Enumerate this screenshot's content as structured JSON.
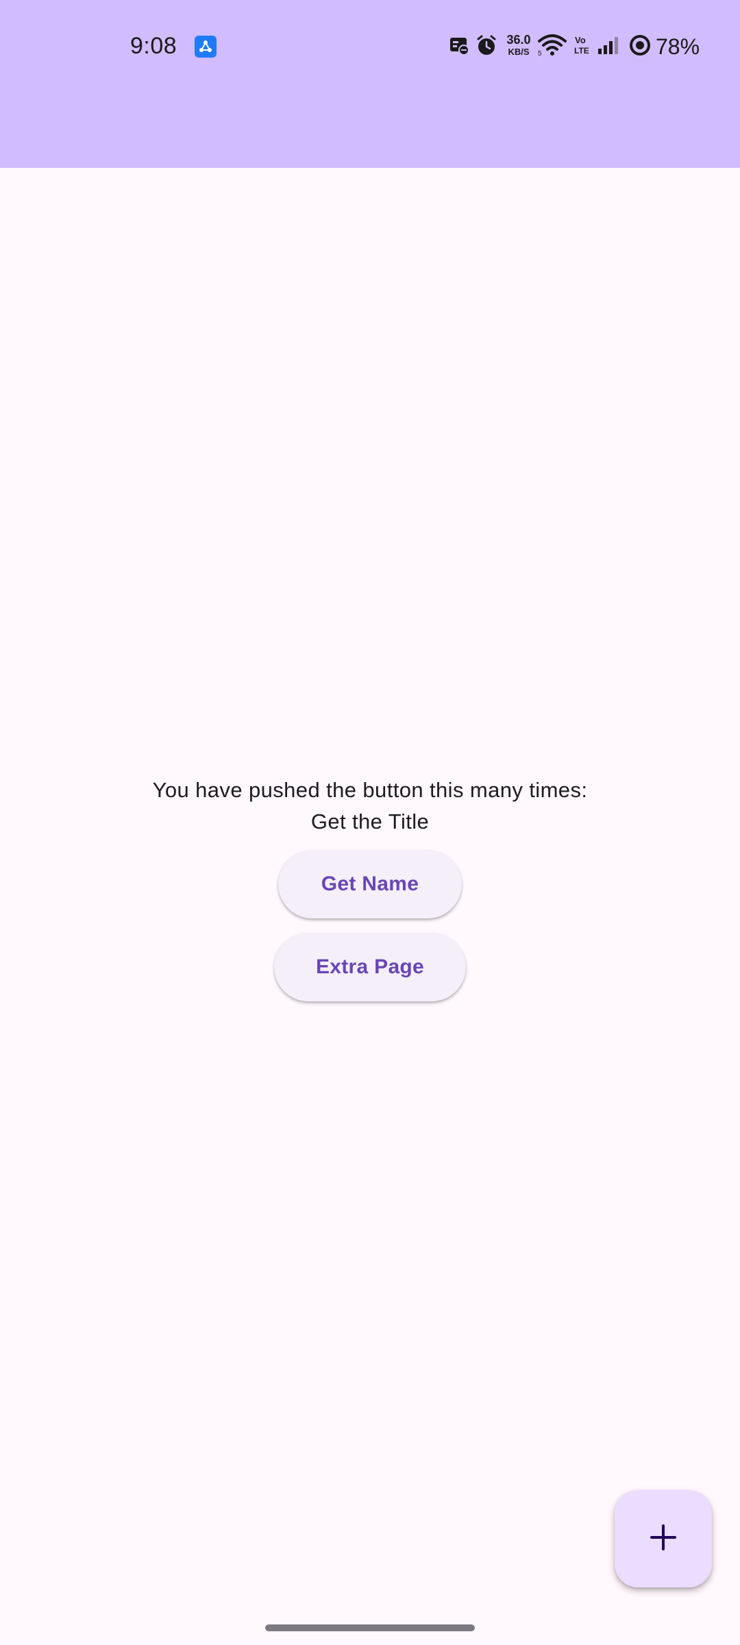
{
  "status_bar": {
    "time": "9:08",
    "net_speed_value": "36.0",
    "net_speed_unit": "KB/S",
    "battery_percent": "78%",
    "icons": [
      "app-badge-icon",
      "notification-icon",
      "alarm-icon",
      "net-speed",
      "wifi-icon",
      "volte-icon",
      "signal-icon",
      "battery-icon"
    ]
  },
  "app_bar": {
    "color": "#D1BCFF"
  },
  "main": {
    "message": "You have pushed the button this many times:",
    "title_text": "Get the Title",
    "buttons": [
      {
        "label": "Get Name"
      },
      {
        "label": "Extra Page"
      }
    ]
  },
  "fab": {
    "icon": "plus-icon",
    "color": "#EADDFF"
  },
  "colors": {
    "background": "#FFF8FD",
    "button_text": "#6A45B5",
    "button_bg": "#F4EFF8"
  }
}
